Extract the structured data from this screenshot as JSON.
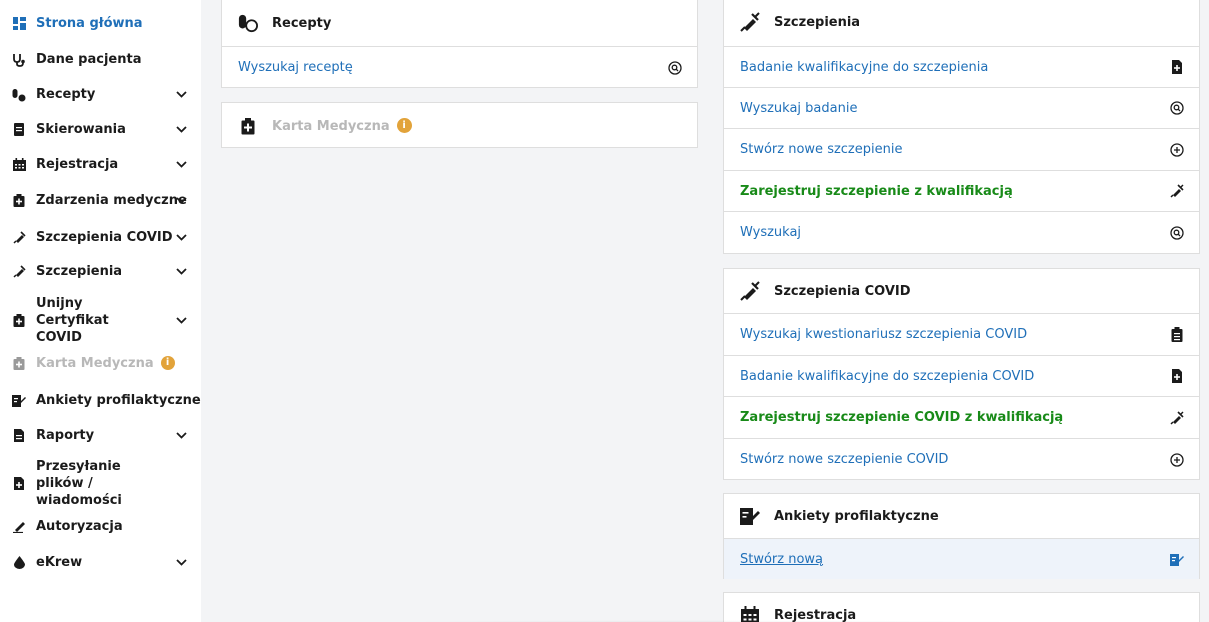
{
  "sidebar": {
    "items": [
      {
        "label": "Strona główna",
        "icon": "dashboard-icon",
        "active": true
      },
      {
        "label": "Dane pacjenta",
        "icon": "stethoscope-icon"
      },
      {
        "label": "Recepty",
        "icon": "pills-icon",
        "expandable": true
      },
      {
        "label": "Skierowania",
        "icon": "document-icon",
        "expandable": true
      },
      {
        "label": "Rejestracja",
        "icon": "calendar-icon",
        "expandable": true
      },
      {
        "label": "Zdarzenia medyczne",
        "icon": "medical-bag-icon",
        "expandable": true
      },
      {
        "label": "Szczepienia COVID",
        "icon": "syringe-icon",
        "expandable": true
      },
      {
        "label": "Szczepienia",
        "icon": "syringe-icon",
        "expandable": true
      },
      {
        "label": "Unijny Certyfikat COVID",
        "icon": "medical-bag-icon",
        "expandable": true
      },
      {
        "label": "Karta Medyczna",
        "icon": "medical-bag-icon",
        "disabled": true,
        "info_badge": "i"
      },
      {
        "label": "Ankiety profilaktyczne",
        "icon": "survey-icon"
      },
      {
        "label": "Raporty",
        "icon": "report-icon",
        "expandable": true
      },
      {
        "label": "Przesyłanie plików / wiadomości",
        "icon": "file-upload-icon"
      },
      {
        "label": "Autoryzacja",
        "icon": "signature-icon"
      },
      {
        "label": "eKrew",
        "icon": "blood-drop-icon",
        "expandable": true
      }
    ]
  },
  "recepty_card": {
    "title": "Recepty",
    "rows": [
      {
        "label": "Wyszukaj receptę",
        "icon": "search-icon"
      }
    ]
  },
  "karta_card": {
    "title": "Karta Medyczna",
    "info_badge": "i"
  },
  "szczepienia_card": {
    "title": "Szczepienia",
    "rows": [
      {
        "label": "Badanie kwalifikacyjne do szczepienia",
        "icon": "add-document-icon"
      },
      {
        "label": "Wyszukaj badanie",
        "icon": "search-icon"
      },
      {
        "label": "Stwórz nowe szczepienie",
        "icon": "plus-circle-icon"
      },
      {
        "label": "Zarejestruj szczepienie z kwalifikacją",
        "icon": "syringe-icon"
      },
      {
        "label": "Wyszukaj",
        "icon": "search-icon"
      }
    ]
  },
  "covid_card": {
    "title": "Szczepienia COVID",
    "rows": [
      {
        "label": "Wyszukaj kwestionariusz szczepienia COVID",
        "icon": "clipboard-icon"
      },
      {
        "label": "Badanie kwalifikacyjne do szczepienia COVID",
        "icon": "add-document-icon"
      },
      {
        "label": "Zarejestruj szczepienie COVID z kwalifikacją",
        "icon": "syringe-icon"
      },
      {
        "label": "Stwórz nowe szczepienie COVID",
        "icon": "plus-circle-icon"
      }
    ]
  },
  "ankiety_card": {
    "title": "Ankiety profilaktyczne",
    "rows": [
      {
        "label": "Stwórz nową",
        "icon": "survey-icon"
      }
    ]
  },
  "rejestracja_card": {
    "title": "Rejestracja"
  },
  "colors": {
    "link": "#1f6fb8",
    "green": "#188a18",
    "disabled": "#b8b8b8",
    "info": "#e2a33a"
  }
}
